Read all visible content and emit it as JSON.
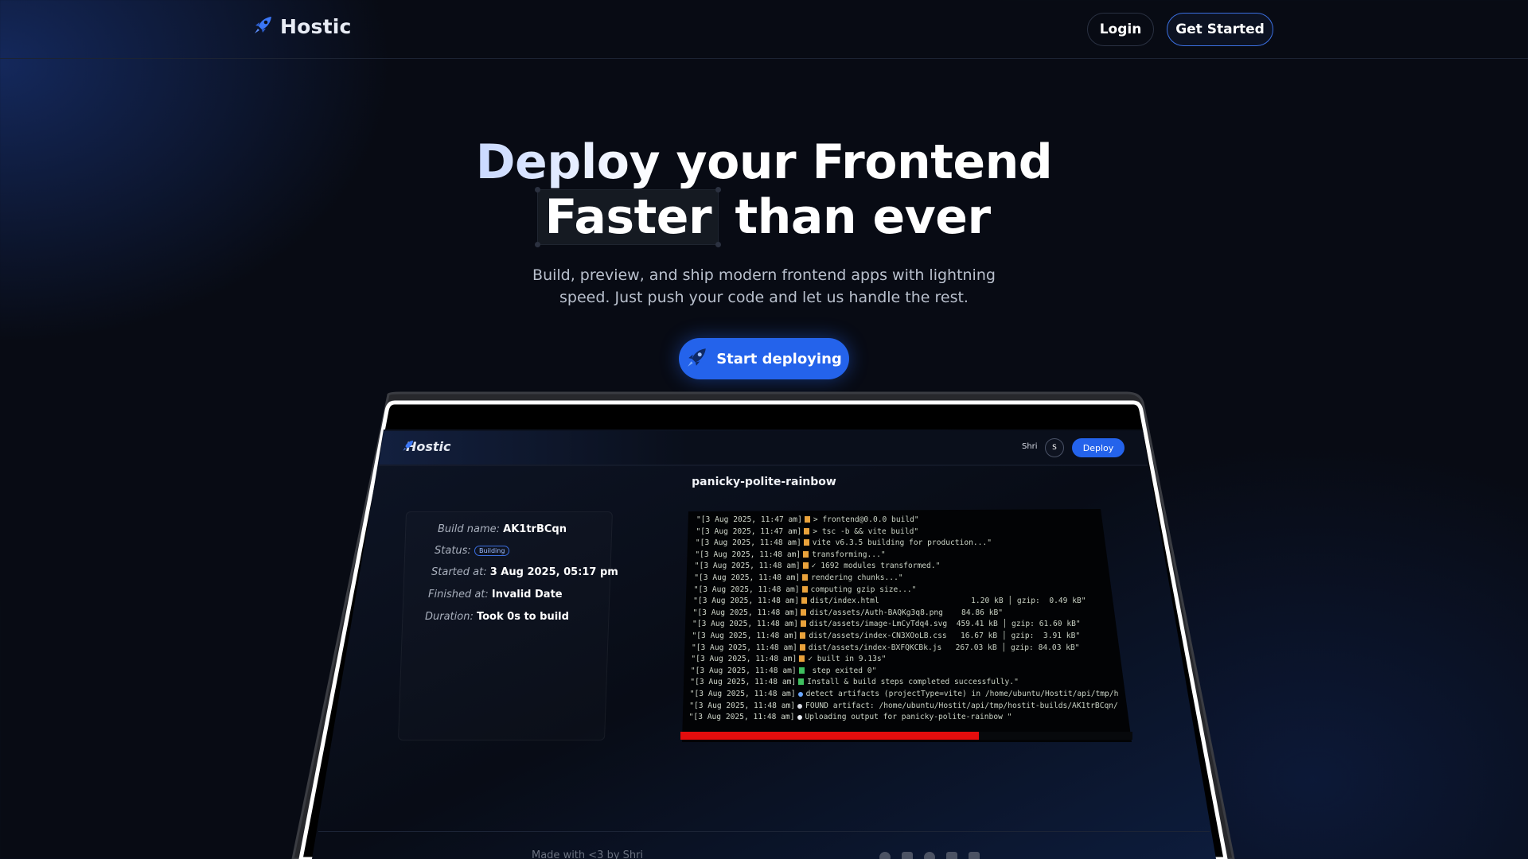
{
  "nav": {
    "brand": "Hostic",
    "login_label": "Login",
    "get_started_label": "Get Started"
  },
  "hero": {
    "title_word1": "Deploy",
    "title_rest": " your Frontend",
    "title_highlight": "Faster",
    "title_tail": " than ever",
    "subtitle": "Build, preview, and ship modern frontend apps with lightning speed. Just push your code and let us handle the rest.",
    "cta_label": "Start deploying"
  },
  "mockup": {
    "brand": "Hostic",
    "user_name": "Shri",
    "avatar_initial": "S",
    "deploy_label": "Deploy",
    "project_name": "panicky-polite-rainbow",
    "build": {
      "name_label": "Build name:",
      "name_value": "AK1trBCqn",
      "status_label": "Status:",
      "status_value": "Building",
      "started_label": "Started at:",
      "started_value": "3 Aug 2025, 05:17 pm",
      "finished_label": "Finished at:",
      "finished_value": "Invalid Date",
      "duration_label": "Duration:",
      "duration_value": "Took 0s to build"
    },
    "logs": [
      {
        "ts": "\"[3 Aug 2025, 11:47 am]",
        "icon": "orange",
        "text": "> frontend@0.0.0 build\""
      },
      {
        "ts": "\"[3 Aug 2025, 11:47 am]",
        "icon": "orange",
        "text": "> tsc -b && vite build\""
      },
      {
        "ts": "\"[3 Aug 2025, 11:48 am]",
        "icon": "orange",
        "text": "vite v6.3.5 building for production...\""
      },
      {
        "ts": "\"[3 Aug 2025, 11:48 am]",
        "icon": "orange",
        "text": "transforming...\""
      },
      {
        "ts": "\"[3 Aug 2025, 11:48 am]",
        "icon": "orange",
        "text": "✓ 1692 modules transformed.\""
      },
      {
        "ts": "\"[3 Aug 2025, 11:48 am]",
        "icon": "orange",
        "text": "rendering chunks...\""
      },
      {
        "ts": "\"[3 Aug 2025, 11:48 am]",
        "icon": "orange",
        "text": "computing gzip size...\""
      },
      {
        "ts": "\"[3 Aug 2025, 11:48 am]",
        "icon": "orange",
        "text": "dist/index.html                    1.20 kB │ gzip:  0.49 kB\""
      },
      {
        "ts": "\"[3 Aug 2025, 11:48 am]",
        "icon": "orange",
        "text": "dist/assets/Auth-BAQKg3q8.png    84.86 kB\""
      },
      {
        "ts": "\"[3 Aug 2025, 11:48 am]",
        "icon": "orange",
        "text": "dist/assets/image-LmCyTdq4.svg  459.41 kB │ gzip: 61.60 kB\""
      },
      {
        "ts": "\"[3 Aug 2025, 11:48 am]",
        "icon": "orange",
        "text": "dist/assets/index-CN3XOoLB.css   16.67 kB │ gzip:  3.91 kB\""
      },
      {
        "ts": "\"[3 Aug 2025, 11:48 am]",
        "icon": "orange",
        "text": "dist/assets/index-BXFQKCBk.js   267.03 kB │ gzip: 84.03 kB\""
      },
      {
        "ts": "\"[3 Aug 2025, 11:48 am]",
        "icon": "orange",
        "text": "✓ built in 9.13s\""
      },
      {
        "ts": "\"[3 Aug 2025, 11:48 am]",
        "icon": "green",
        "text": " step exited 0\""
      },
      {
        "ts": "\"[3 Aug 2025, 11:48 am]",
        "icon": "green",
        "text": "Install & build steps completed successfully.\""
      },
      {
        "ts": "\"[3 Aug 2025, 11:48 am]",
        "icon": "search",
        "text": "detect artifacts (projectType=vite) in /home/ubuntu/Hostit/api/tmp/h"
      },
      {
        "ts": "\"[3 Aug 2025, 11:48 am]",
        "icon": "dot",
        "text": "FOUND artifact: /home/ubuntu/Hostit/api/tmp/hostit-builds/AK1trBCqn/"
      },
      {
        "ts": "\"[3 Aug 2025, 11:48 am]",
        "icon": "cloud",
        "text": "Uploading output for panicky-polite-rainbow \""
      }
    ],
    "progress_fraction": 0.66,
    "footer_text": "Made with <3 by Shri"
  },
  "colors": {
    "accent": "#2463eb",
    "progress": "#e40d0d",
    "log_orange": "#e9a23b",
    "log_green": "#3fbf5f"
  }
}
